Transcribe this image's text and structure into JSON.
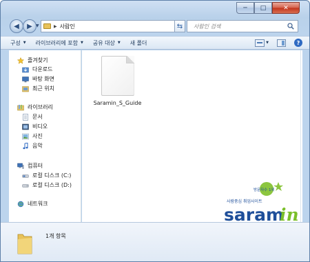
{
  "window": {
    "caption_buttons": {
      "minimize": "─",
      "maximize": "□",
      "close": "✕"
    }
  },
  "address": {
    "path": "사람인",
    "search_placeholder": "사람인 검색"
  },
  "toolbar": {
    "organize": "구성",
    "include_in_library": "라이브러리에 포함",
    "share_with": "공유 대상",
    "new_folder": "새 폴더"
  },
  "nav": {
    "favorites": "즐겨찾기",
    "downloads": "다운로드",
    "desktop": "바탕 화면",
    "recent_places": "최근 위치",
    "libraries": "라이브러리",
    "documents": "문서",
    "videos": "비디오",
    "pictures": "사진",
    "music": "음악",
    "computer": "컴퓨터",
    "local_disk_c": "로컬 디스크 (C:)",
    "local_disk_d": "로컬 디스크 (D:)",
    "network": "네트워크"
  },
  "files": [
    {
      "name": "Saramin_S_Guide",
      "icon": "generic-file-icon"
    }
  ],
  "logo": {
    "badge": "방문자수 1위",
    "tagline": "사람중심 취업사이트",
    "wordmark_main": "saram",
    "wordmark_accent": "in",
    "colors": {
      "blue": "#1f4f9a",
      "green": "#7bbf2a"
    }
  },
  "status": {
    "item_count": "1개 항목"
  }
}
